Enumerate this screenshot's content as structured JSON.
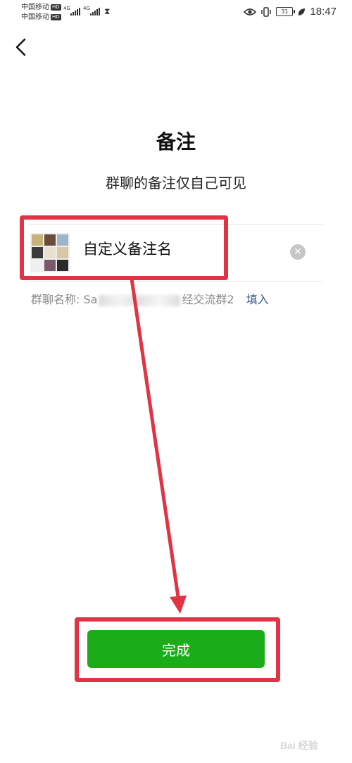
{
  "status_bar": {
    "carrier1": "中国移动",
    "carrier2": "中国移动",
    "hd": "HD",
    "sig1": "4G",
    "sig2": "4G",
    "battery": "31",
    "time": "18:47"
  },
  "header": {
    "title": "备注",
    "subtitle": "群聊的备注仅自己可见"
  },
  "remark_field": {
    "value": "自定义备注名"
  },
  "group_name": {
    "label": "群聊名称:",
    "prefix": "Sa",
    "suffix": "经交流群2",
    "fill_link": "填入"
  },
  "done_button": {
    "label": "完成",
    "color": "#1aad19"
  },
  "annotation": {
    "color": "#e03345"
  },
  "watermark": {
    "text": "Bai 经验"
  },
  "icons": [
    "back-arrow-icon",
    "eye-icon",
    "vibrate-icon",
    "battery-icon",
    "leaf-icon",
    "clear-icon",
    "hourglass-icon"
  ]
}
